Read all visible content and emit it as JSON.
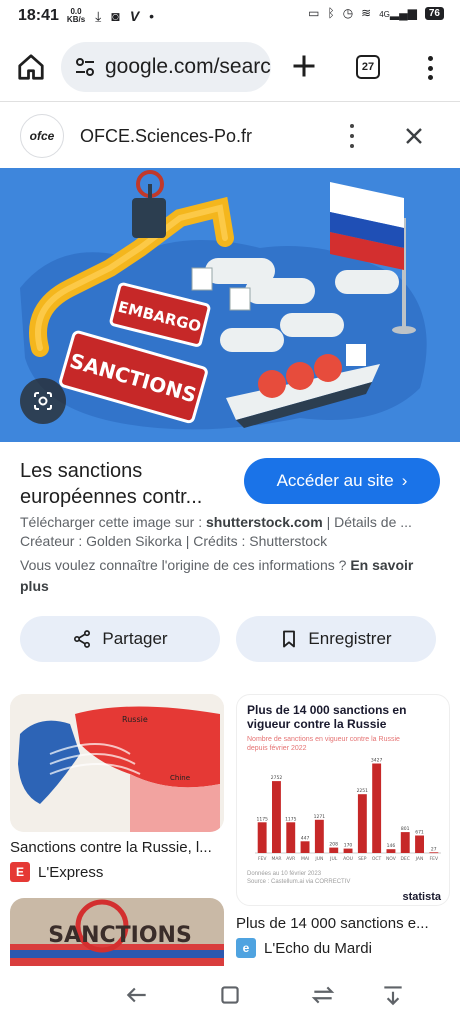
{
  "status": {
    "time": "18:41",
    "speed_value": "0.0",
    "speed_unit": "KB/s",
    "battery": "76",
    "signal_label": "4G"
  },
  "browser": {
    "url": "google.com/search",
    "tab_count": "27"
  },
  "source": {
    "logo_text": "ofce",
    "name": "OFCE.Sciences-Po.fr"
  },
  "hero": {
    "sign_embargo": "EMBARGO",
    "sign_sanctions": "SANCTIONS"
  },
  "result": {
    "title": "Les sanctions européennes contr...",
    "visit_label": "Accéder au site",
    "download_prefix": "Télécharger cette image sur : ",
    "download_site": "shutterstock.com",
    "download_suffix": " | Détails de ...",
    "credits": "Créateur : Golden Sikorka | Crédits : Shutterstock",
    "origin_question": "Vous voulez connaître l'origine de ces informations ? ",
    "learn_more": "En savoir plus"
  },
  "actions": {
    "share": "Partager",
    "save": "Enregistrer"
  },
  "related": [
    {
      "caption": "Sanctions contre la Russie, l...",
      "source": "L'Express",
      "fav": "E"
    },
    {
      "caption": "Plus de 14 000 sanctions e...",
      "source": "L'Echo du Mardi",
      "fav": "e"
    }
  ],
  "statista_card": {
    "title": "Plus de 14 000 sanctions en vigueur contre la Russie",
    "subtitle": "Nombre de sanctions en vigueur contre la Russie depuis février 2022",
    "brand": "statista",
    "note": "Données au 10 février 2023",
    "source": "Source : Castellum.ai via CORRECTIV"
  },
  "chart_data": {
    "type": "bar",
    "categories": [
      "FEV",
      "MAR",
      "AVR",
      "MAI",
      "JUN",
      "JUL",
      "AOU",
      "SEP",
      "OCT",
      "NOV",
      "DEC",
      "JAN",
      "FEV"
    ],
    "values": [
      1175,
      2752,
      1175,
      447,
      1271,
      208,
      170,
      2251,
      3427,
      146,
      801,
      671,
      27
    ],
    "ylim": [
      0,
      3600
    ]
  },
  "map_card": {
    "label_russia": "Russie",
    "label_china": "Chine"
  },
  "sanctions_card": {
    "text": "SANCTIONS"
  }
}
